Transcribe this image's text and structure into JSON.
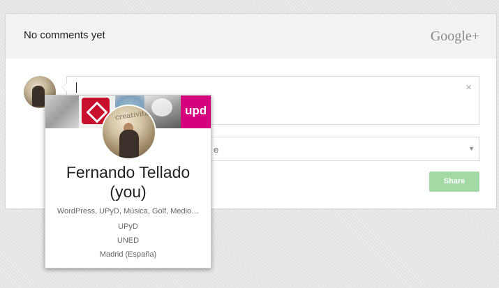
{
  "header": {
    "title": "No comments yet",
    "brand": "Google+"
  },
  "comment": {
    "value": "",
    "clear_symbol": "×"
  },
  "share_select": {
    "visible_fragment": "e",
    "arrow": "▼"
  },
  "share_button": {
    "label": "Share"
  },
  "hovercard": {
    "cover_text": "upd",
    "name_line1": "Fernando Tellado",
    "name_line2": "(you)",
    "details": [
      "WordPress, UPyD, Música, Golf, Medio…",
      "UPyD",
      "UNED",
      "Madrid (España)"
    ],
    "avatar_word": "creativitat"
  },
  "colors": {
    "share_button": "#a3d9a5",
    "upd_brand": "#d6007e",
    "header_bg": "#f3f3f3"
  }
}
